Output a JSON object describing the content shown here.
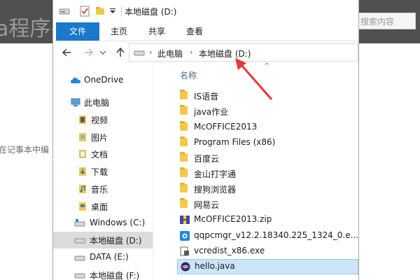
{
  "background": {
    "title": "a程序并",
    "search_placeholder": "搜索内容",
    "text": "在记事本中编"
  },
  "window": {
    "title": "本地磁盘 (D:)",
    "ribbon_tabs": [
      "文件",
      "主页",
      "共享",
      "查看"
    ]
  },
  "address": {
    "crumbs": [
      "此电脑",
      "本地磁盘 (D:)"
    ]
  },
  "nav_pane": {
    "items": [
      {
        "label": "OneDrive",
        "icon": "cloud-icon"
      },
      {
        "label": "此电脑",
        "icon": "computer-icon"
      },
      {
        "label": "视频",
        "icon": "video-folder-icon"
      },
      {
        "label": "图片",
        "icon": "pictures-folder-icon"
      },
      {
        "label": "文档",
        "icon": "documents-folder-icon"
      },
      {
        "label": "下载",
        "icon": "downloads-folder-icon"
      },
      {
        "label": "音乐",
        "icon": "music-folder-icon"
      },
      {
        "label": "桌面",
        "icon": "desktop-folder-icon"
      },
      {
        "label": "Windows (C:)",
        "icon": "drive-icon"
      },
      {
        "label": "本地磁盘 (D:)",
        "icon": "drive-icon"
      },
      {
        "label": "DATA (E:)",
        "icon": "drive-icon"
      },
      {
        "label": "本地磁盘 (F:)",
        "icon": "drive-icon"
      }
    ],
    "selected": "本地磁盘 (D:)"
  },
  "file_list": {
    "column_header": "名称",
    "rows": [
      {
        "label": "IS语音",
        "icon": "folder-icon"
      },
      {
        "label": "java作业",
        "icon": "folder-icon"
      },
      {
        "label": "McOFFICE2013",
        "icon": "folder-icon"
      },
      {
        "label": "Program Files (x86)",
        "icon": "folder-icon"
      },
      {
        "label": "百度云",
        "icon": "folder-icon"
      },
      {
        "label": "金山打字通",
        "icon": "folder-icon"
      },
      {
        "label": "搜狗浏览器",
        "icon": "folder-icon"
      },
      {
        "label": "网易云",
        "icon": "folder-icon"
      },
      {
        "label": "McOFFICE2013.zip",
        "icon": "zip-icon"
      },
      {
        "label": "qqpcmgr_v12.2.18340.225_1324_0.e...",
        "icon": "installer-icon"
      },
      {
        "label": "vcredist_x86.exe",
        "icon": "exe-icon"
      },
      {
        "label": "hello.java",
        "icon": "java-file-icon"
      }
    ],
    "selected": "hello.java"
  },
  "colors": {
    "accent": "#1979ca",
    "selection": "#cce4f7",
    "annotation_arrow": "#e53935"
  }
}
